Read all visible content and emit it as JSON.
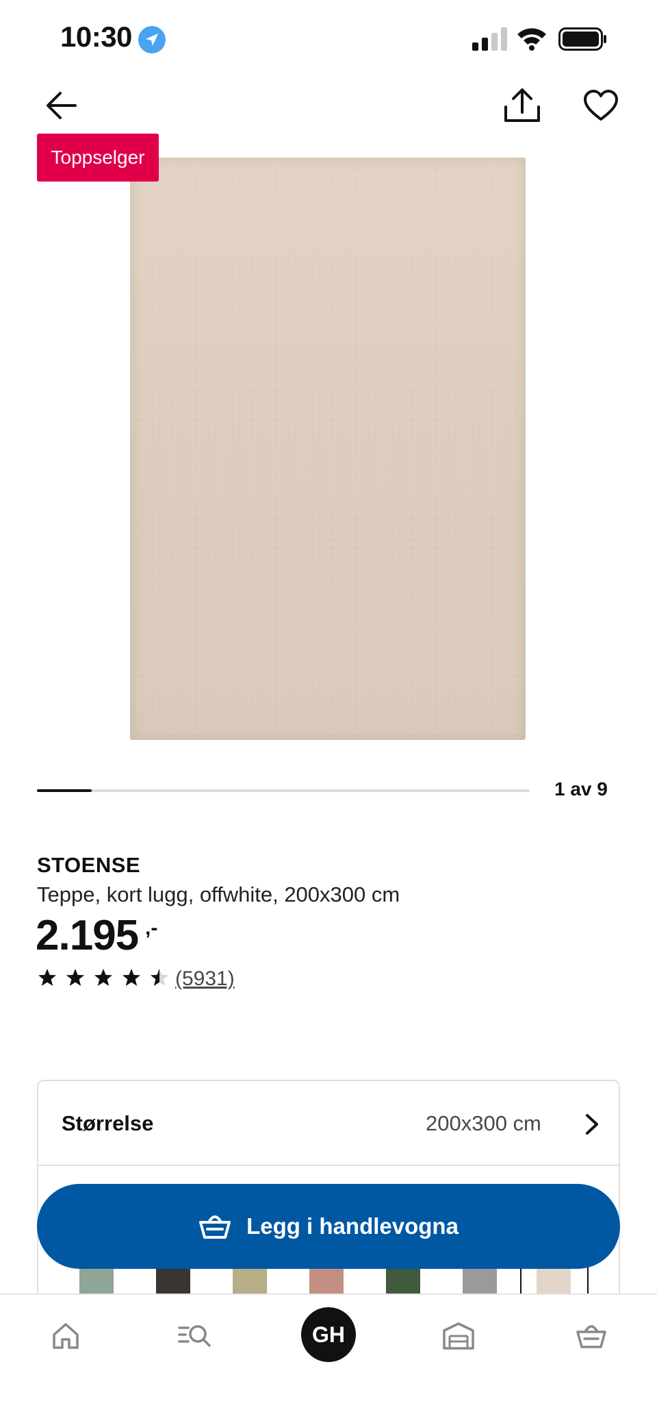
{
  "status_bar": {
    "time": "10:30"
  },
  "icons": {
    "location": "location-arrow-icon",
    "signal": "cell-signal-icon",
    "wifi": "wifi-icon",
    "battery": "battery-icon",
    "back": "arrow-left-icon",
    "share": "share-icon",
    "favorite": "heart-icon",
    "chevron": "chevron-right-icon",
    "cart": "basket-icon"
  },
  "product": {
    "badge": "Toppselger",
    "name": "STOENSE",
    "description": "Teppe, kort lugg, offwhite, 200x300 cm",
    "price": "2.195",
    "price_suffix": ",-",
    "rating": 4.5,
    "review_count": "(5931)"
  },
  "gallery": {
    "current": 1,
    "total": 9,
    "label": "1 av 9"
  },
  "options": {
    "size_label": "Størrelse",
    "size_value": "200x300 cm"
  },
  "swatches": [
    "#8fa596",
    "#3b3532",
    "#b7ad86",
    "#c48f83",
    "#3f5a3d",
    "#9a9a9a",
    "#e3d6c8"
  ],
  "cart_button": {
    "label": "Legg i handlevogna"
  },
  "bottom_nav": {
    "profile_initials": "GH"
  },
  "colors": {
    "accent_blue": "#0058a3",
    "badge_red": "#e0004a"
  }
}
